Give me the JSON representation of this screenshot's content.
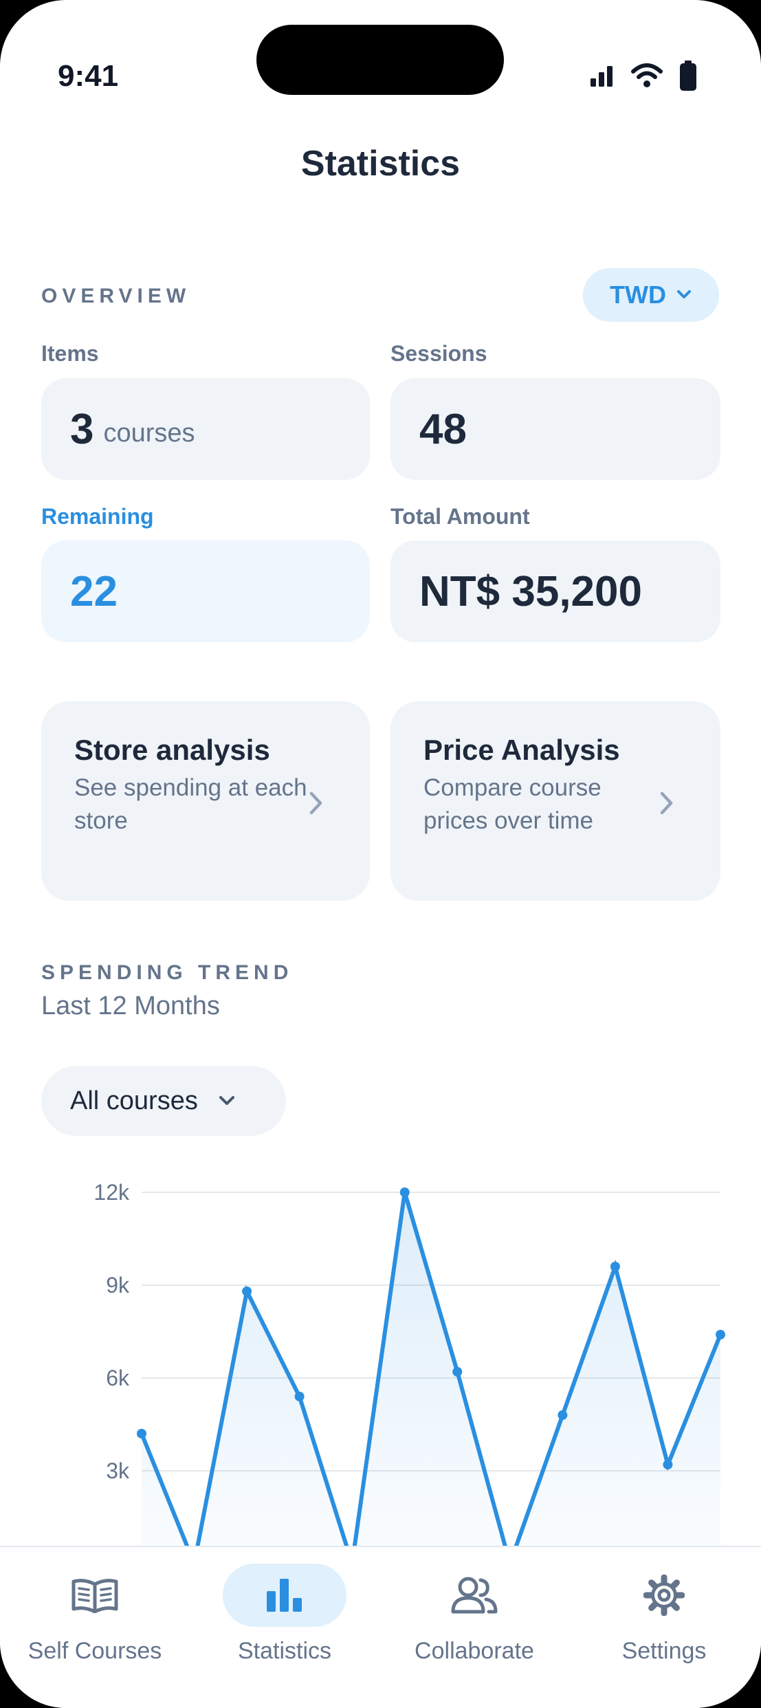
{
  "status_bar": {
    "time": "9:41"
  },
  "header": {
    "title": "Statistics"
  },
  "overview": {
    "section_label": "OVERVIEW",
    "currency": "TWD",
    "items": {
      "label": "Items",
      "value": "3",
      "unit": "courses"
    },
    "sessions": {
      "label": "Sessions",
      "value": "48"
    },
    "remaining": {
      "label": "Remaining",
      "value": "22"
    },
    "total_amount": {
      "label": "Total Amount",
      "value": "NT$ 35,200"
    }
  },
  "nav_cards": {
    "store": {
      "title": "Store analysis",
      "description": "See spending at each store"
    },
    "price": {
      "title": "Price Analysis",
      "description": "Compare course prices over time"
    }
  },
  "trend": {
    "section_label": "SPENDING TREND",
    "subtitle": "Last 12 Months",
    "filter": "All courses"
  },
  "chart_data": {
    "type": "area",
    "y_ticks": [
      "12k",
      "9k",
      "6k",
      "3k"
    ],
    "ylim": [
      0,
      12000
    ],
    "x": [
      1,
      2,
      3,
      4,
      5,
      6,
      7,
      8,
      9,
      10,
      11,
      12
    ],
    "values": [
      4200,
      0,
      8800,
      5400,
      0,
      12000,
      6200,
      0,
      4800,
      9600,
      3200,
      7400
    ],
    "grid": true,
    "color": "#2a8fe0"
  },
  "tabs": [
    {
      "label": "Self Courses",
      "icon": "book-icon"
    },
    {
      "label": "Statistics",
      "icon": "bar-chart-icon"
    },
    {
      "label": "Collaborate",
      "icon": "users-icon"
    },
    {
      "label": "Settings",
      "icon": "gear-icon"
    }
  ],
  "colors": {
    "accent": "#2a8fe0",
    "card": "#f0f4f8",
    "text": "#1e293b",
    "muted": "#64748b"
  }
}
